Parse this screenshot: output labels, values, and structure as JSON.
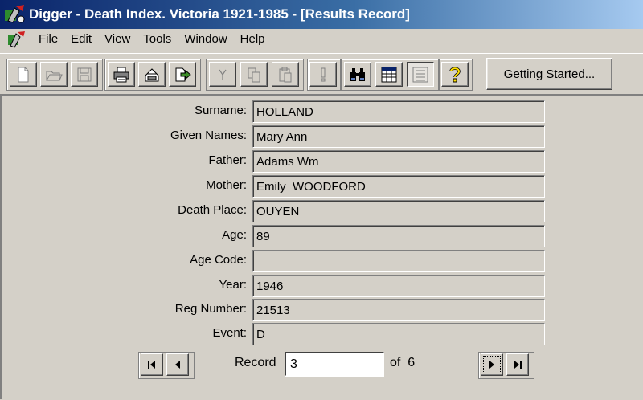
{
  "window": {
    "title": "Digger - Death Index. Victoria 1921-1985 - [Results Record]"
  },
  "menu": [
    "File",
    "Edit",
    "View",
    "Tools",
    "Window",
    "Help"
  ],
  "toolbar": {
    "buttons": [
      "new-document",
      "open-folder",
      "save",
      "print",
      "print-setup",
      "export",
      "filter",
      "copy",
      "paste",
      "alert",
      "find-binoculars",
      "table-view",
      "record-view",
      "help-question"
    ],
    "getting_started_label": "Getting Started..."
  },
  "record": {
    "fields": [
      {
        "label": "Surname:",
        "value": "HOLLAND"
      },
      {
        "label": "Given Names:",
        "value": "Mary Ann"
      },
      {
        "label": "Father:",
        "value": "Adams Wm"
      },
      {
        "label": "Mother:",
        "value": "Emily  WOODFORD"
      },
      {
        "label": "Death Place:",
        "value": "OUYEN"
      },
      {
        "label": "Age:",
        "value": "89"
      },
      {
        "label": "Age Code:",
        "value": ""
      },
      {
        "label": "Year:",
        "value": "1946"
      },
      {
        "label": "Reg Number:",
        "value": "21513"
      },
      {
        "label": "Event:",
        "value": "D"
      }
    ]
  },
  "navigation": {
    "record_label": "Record",
    "current": "3",
    "of_label": "of",
    "total": "6"
  }
}
